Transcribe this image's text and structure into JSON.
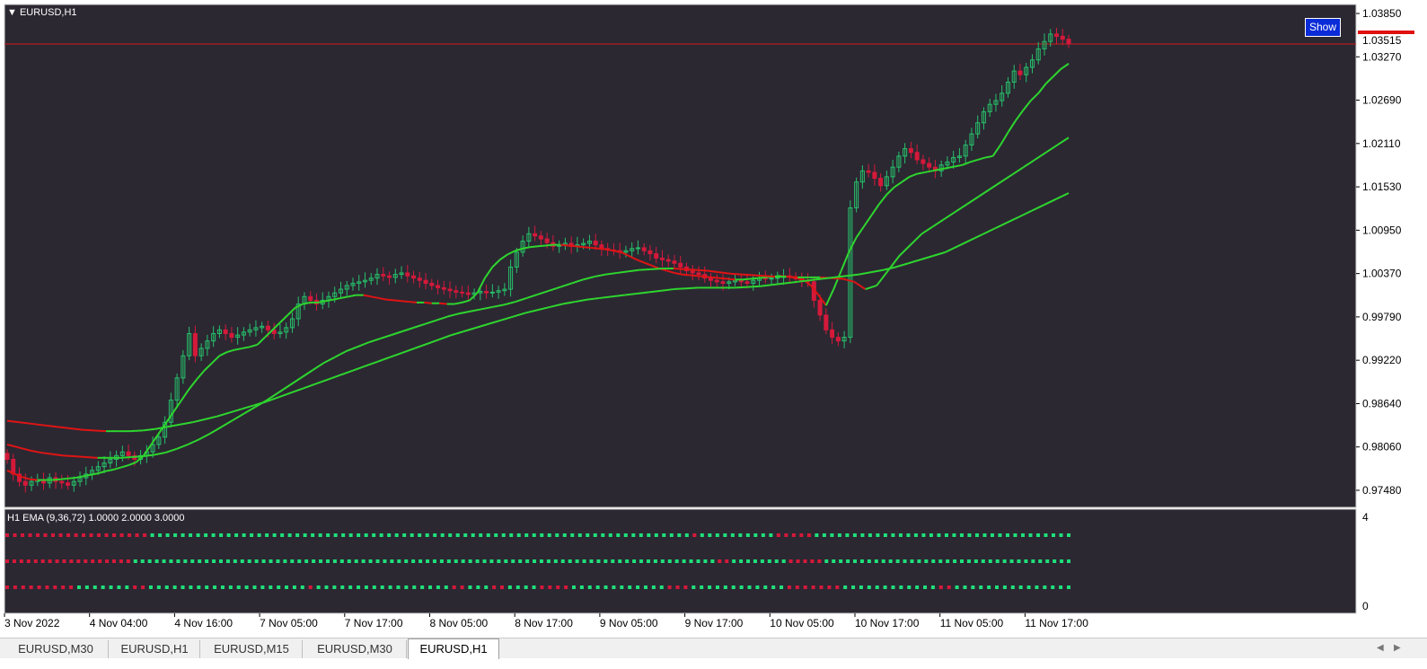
{
  "symbol_title": "EURUSD,H1",
  "indicator_title": "H1 EMA (9,36,72) 1.0000 2.0000 3.0000",
  "show_button_label": "Show",
  "current_price": "1.03515",
  "colors": {
    "chart_bg": "#2b2832",
    "bull": "#27c06a",
    "bear": "#d5193a",
    "ema_up": "#2ed52e",
    "ema_down": "#e01414",
    "price_line": "#d21c1c",
    "dot_green": "#1fe07a",
    "dot_red": "#d5193a"
  },
  "price_axis_labels": [
    "1.03850",
    "1.03270",
    "1.02690",
    "1.02110",
    "1.01530",
    "1.00950",
    "1.00370",
    "0.99790",
    "0.99220",
    "0.98640",
    "0.98060",
    "0.97480"
  ],
  "indicator_axis_labels": [
    "4",
    "0"
  ],
  "time_axis_labels": [
    "3 Nov 2022",
    "4 Nov 04:00",
    "4 Nov 16:00",
    "7 Nov 05:00",
    "7 Nov 17:00",
    "8 Nov 05:00",
    "8 Nov 17:00",
    "9 Nov 05:00",
    "9 Nov 17:00",
    "10 Nov 05:00",
    "10 Nov 17:00",
    "11 Nov 05:00",
    "11 Nov 17:00"
  ],
  "tabs": [
    {
      "label": "EURUSD,M30",
      "active": false
    },
    {
      "label": "EURUSD,H1",
      "active": false
    },
    {
      "label": "EURUSD,M15",
      "active": false
    },
    {
      "label": "EURUSD,M30",
      "active": false
    },
    {
      "label": "EURUSD,H1",
      "active": true
    }
  ],
  "scroll_icons": [
    "scroll-left-icon",
    "scroll-right-icon"
  ],
  "chart_data": {
    "type": "candlestick",
    "price_range": [
      0.9725,
      1.0405
    ],
    "closes": [
      0.979,
      0.977,
      0.976,
      0.9755,
      0.976,
      0.9762,
      0.9758,
      0.9765,
      0.976,
      0.9758,
      0.9755,
      0.976,
      0.9765,
      0.977,
      0.9775,
      0.978,
      0.9785,
      0.979,
      0.9795,
      0.98,
      0.9795,
      0.979,
      0.9795,
      0.98,
      0.981,
      0.982,
      0.984,
      0.987,
      0.99,
      0.993,
      0.996,
      0.993,
      0.994,
      0.995,
      0.996,
      0.9965,
      0.996,
      0.9955,
      0.9958,
      0.9962,
      0.9965,
      0.9968,
      0.997,
      0.9965,
      0.996,
      0.9962,
      0.9968,
      0.998,
      1.0,
      1.001,
      1.0005,
      1.0,
      1.0005,
      1.001,
      1.0015,
      1.002,
      1.0025,
      1.0028,
      1.003,
      1.0032,
      1.0035,
      1.004,
      1.0038,
      1.0036,
      1.004,
      1.0042,
      1.0038,
      1.0035,
      1.0032,
      1.0028,
      1.0025,
      1.0022,
      1.002,
      1.0018,
      1.0016,
      1.0015,
      1.0013,
      1.0015,
      1.0017,
      1.0015,
      1.0016,
      1.0018,
      1.002,
      1.005,
      1.007,
      1.0085,
      1.0095,
      1.0092,
      1.0088,
      1.0083,
      1.0078,
      1.008,
      1.0082,
      1.0078,
      1.008,
      1.0082,
      1.0085,
      1.008,
      1.0075,
      1.0073,
      1.0072,
      1.007,
      1.0072,
      1.0075,
      1.0076,
      1.0072,
      1.0068,
      1.0062,
      1.006,
      1.0058,
      1.0055,
      1.005,
      1.0045,
      1.0042,
      1.004,
      1.0035,
      1.0032,
      1.003,
      1.0028,
      1.003,
      1.0032,
      1.003,
      1.0028,
      1.0032,
      1.0035,
      1.0034,
      1.0035,
      1.0036,
      1.0038,
      1.0036,
      1.0034,
      1.0032,
      1.003,
      1.0005,
      0.9985,
      0.9965,
      0.9955,
      0.995,
      0.9955,
      1.013,
      1.0165,
      1.018,
      1.0178,
      1.017,
      1.016,
      1.0172,
      1.0185,
      1.02,
      1.021,
      1.0205,
      1.0195,
      1.019,
      1.0185,
      1.018,
      1.0188,
      1.0192,
      1.0198,
      1.02,
      1.0215,
      1.023,
      1.0245,
      1.026,
      1.027,
      1.0275,
      1.0285,
      1.03,
      1.0315,
      1.031,
      1.032,
      1.033,
      1.0345,
      1.0355,
      1.0365,
      1.0362,
      1.0358,
      1.0352
    ],
    "ema9": [
      0.9775,
      0.977,
      0.9766,
      0.9763,
      0.9762,
      0.9762,
      0.9762,
      0.9763,
      0.9764,
      0.9765,
      0.9767,
      0.9769,
      0.9771,
      0.9774,
      0.9776,
      0.9779,
      0.9782,
      0.9786,
      0.9795,
      0.981,
      0.9825,
      0.984,
      0.9855,
      0.987,
      0.9885,
      0.9898,
      0.991,
      0.992,
      0.993,
      0.9935,
      0.9938,
      0.994,
      0.9942,
      0.9945,
      0.9955,
      0.9965,
      0.9975,
      0.9985,
      0.9995,
      1.0,
      1.0002,
      1.0002,
      1.0004,
      1.0006,
      1.0008,
      1.001,
      1.0012,
      1.0012,
      1.001,
      1.0008,
      1.0006,
      1.0005,
      1.0004,
      1.0003,
      1.0002,
      1.0002,
      1.0001,
      1.0001,
      1.0,
      1.0,
      1.0002,
      1.0005,
      1.0015,
      1.0035,
      1.005,
      1.006,
      1.0067,
      1.0072,
      1.0075,
      1.0077,
      1.0078,
      1.0079,
      1.008,
      1.008,
      1.0079,
      1.0078,
      1.0077,
      1.0076,
      1.0075,
      1.0074,
      1.0072,
      1.007,
      1.0065,
      1.006,
      1.0056,
      1.0052,
      1.0048,
      1.0045,
      1.0042,
      1.004,
      1.0039,
      1.0038,
      1.0037,
      1.0036,
      1.0035,
      1.0034,
      1.0033,
      1.0033,
      1.0034,
      1.0035,
      1.0036,
      1.0037,
      1.0038,
      1.0037,
      1.0035,
      1.0033,
      1.0025,
      1.0012,
      0.9998,
      1.002,
      1.0045,
      1.007,
      1.009,
      1.0105,
      1.012,
      1.0135,
      1.0148,
      1.0158,
      1.0165,
      1.0172,
      1.0176,
      1.0178,
      1.018,
      1.0182,
      1.0184,
      1.0186,
      1.0188,
      1.0192,
      1.0195,
      1.0198,
      1.02,
      1.0215,
      1.0232,
      1.0248,
      1.0262,
      1.0275,
      1.0285,
      1.0298,
      1.0308,
      1.0318,
      1.0325
    ],
    "ema36": [
      0.981,
      0.9806,
      0.9802,
      0.9799,
      0.9797,
      0.9795,
      0.9794,
      0.9793,
      0.9792,
      0.9792,
      0.9792,
      0.9793,
      0.9794,
      0.9796,
      0.9799,
      0.9804,
      0.981,
      0.9817,
      0.9825,
      0.9834,
      0.9843,
      0.9852,
      0.9861,
      0.987,
      0.988,
      0.989,
      0.99,
      0.991,
      0.992,
      0.9928,
      0.9936,
      0.9942,
      0.9948,
      0.9953,
      0.9958,
      0.9963,
      0.9968,
      0.9973,
      0.9978,
      0.9983,
      0.9987,
      0.999,
      0.9993,
      0.9996,
      0.9999,
      1.0003,
      1.0008,
      1.0013,
      1.0018,
      1.0023,
      1.0028,
      1.0033,
      1.0037,
      1.004,
      1.0042,
      1.0044,
      1.0046,
      1.0047,
      1.0048,
      1.0048,
      1.0047,
      1.0046,
      1.0045,
      1.0043,
      1.0041,
      1.004,
      1.0039,
      1.0038,
      1.0037,
      1.0037,
      1.0036,
      1.0036,
      1.0036,
      1.0035,
      1.0034,
      1.003,
      1.002,
      1.0025,
      1.0045,
      1.0065,
      1.008,
      1.0095,
      1.0105,
      1.0115,
      1.0125,
      1.0135,
      1.0145,
      1.0155,
      1.0165,
      1.0175,
      1.0185,
      1.0195,
      1.0205,
      1.0215,
      1.0225
    ],
    "ema72": [
      0.9842,
      0.984,
      0.9838,
      0.9836,
      0.9834,
      0.9832,
      0.983,
      0.9829,
      0.9828,
      0.9828,
      0.9828,
      0.9829,
      0.9831,
      0.9834,
      0.9837,
      0.984,
      0.9844,
      0.9848,
      0.9853,
      0.9858,
      0.9863,
      0.9868,
      0.9874,
      0.988,
      0.9886,
      0.9892,
      0.9898,
      0.9904,
      0.991,
      0.9916,
      0.9922,
      0.9928,
      0.9934,
      0.994,
      0.9946,
      0.9952,
      0.9958,
      0.9963,
      0.9968,
      0.9973,
      0.9978,
      0.9983,
      0.9988,
      0.9992,
      0.9996,
      1.0,
      1.0003,
      1.0006,
      1.0008,
      1.001,
      1.0012,
      1.0014,
      1.0016,
      1.0018,
      1.002,
      1.0021,
      1.0022,
      1.0022,
      1.0022,
      1.0022,
      1.0023,
      1.0024,
      1.0026,
      1.0028,
      1.003,
      1.0032,
      1.0034,
      1.0036,
      1.0038,
      1.004,
      1.0043,
      1.0046,
      1.005,
      1.0055,
      1.006,
      1.0065,
      1.007,
      1.0078,
      1.0086,
      1.0094,
      1.0102,
      1.011,
      1.0118,
      1.0126,
      1.0134,
      1.0142,
      1.015
    ]
  },
  "indicator_dots": {
    "row1": "RRRRRRRRRRRRRRRRRRRGGGGGGGGGGGGGGGGGGGGGGGGGGGGGGGGGGGGGGGGGGGGGGGGGGGGGGGGGGGGGGGGGGGGGGGRGGGGGGGGGGRRRRRGGGGGGGGGGGGGGGGGGGGGGGGGGGGGGGGGG",
    "row2": "RRRRRRRRRRRRRRRRRRGGGGGGGGGGGGGGGGGGGGGGGGGGGGGGGGGGGGGGGGGGGGGGGGGGGGGGGGGGGGGGGGGGGGGGGGGGGGGGGGGGRRGGGGGGGGRRRRRGGGGGGGGGGGGGGGGGGGGGGGGGGGGGGGGGGG",
    "row3": "RRRRRRRRRGGGGGGGRRGGGGGGGGGGGGGGGGGGGGRGGGGGGGGGGGGGGGGGRRGGGRRGGGGRRRRGGGGGGGGGGGGRRRGGGGGGGGGGGGRRRRRRRGGGGGGGGGGGGRRGGGGGGGGGGGGGGG"
  }
}
